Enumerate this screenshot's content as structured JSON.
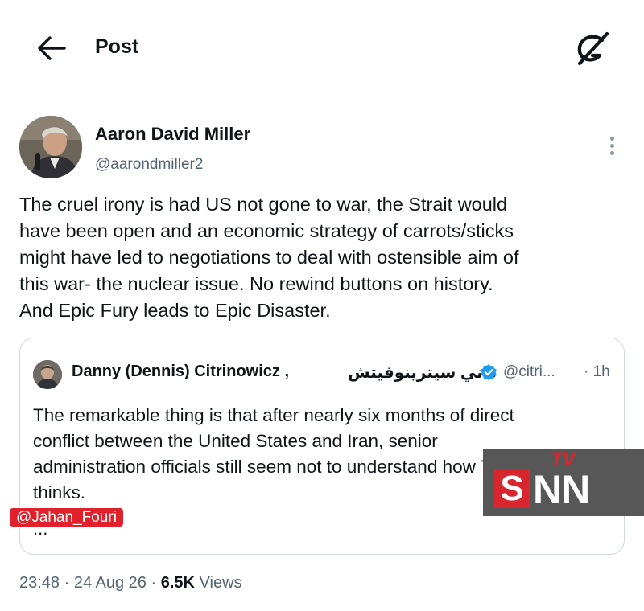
{
  "header": {
    "title": "Post",
    "back_icon": "arrow-left-icon",
    "grok_icon": "grok-icon"
  },
  "author": {
    "name": "Aaron David Miller",
    "handle": "@aarondmiller2"
  },
  "tweet": {
    "text": "The cruel irony is had US  not gone to war, the Strait would\nhave been open and an economic strategy of carrots/sticks\nmight have led to negotiations to deal with ostensible aim of\nthis war- the nuclear issue. No rewind buttons on history.\nAnd Epic Fury leads to Epic Disaster."
  },
  "quoted": {
    "name": "Danny (Dennis) Citrinowicz ,",
    "name_rtl": "داني سيترينوفيتش",
    "handle": "@citri...",
    "time": "· 1h",
    "text": "The remarkable thing is that after nearly six months of direct\nconflict between the United States and Iran, senior\nadministration officials still seem not to understand how Tehran\nthinks.",
    "ellipsis": "..."
  },
  "meta": {
    "time": "23:48",
    "sep1": " · ",
    "date": "24 Aug 26",
    "sep2": " · ",
    "views_count": "6.5K",
    "views_label": " Views"
  },
  "watermark": {
    "handle": "@Jahan_Fouri",
    "logo_tv": "TV",
    "logo_s": "S",
    "logo_nn": "NN"
  },
  "colors": {
    "text_primary": "#0f1419",
    "text_secondary": "#536471",
    "border": "#cfd9de",
    "verified": "#1d9bf0",
    "watermark_red": "#e0202a"
  }
}
